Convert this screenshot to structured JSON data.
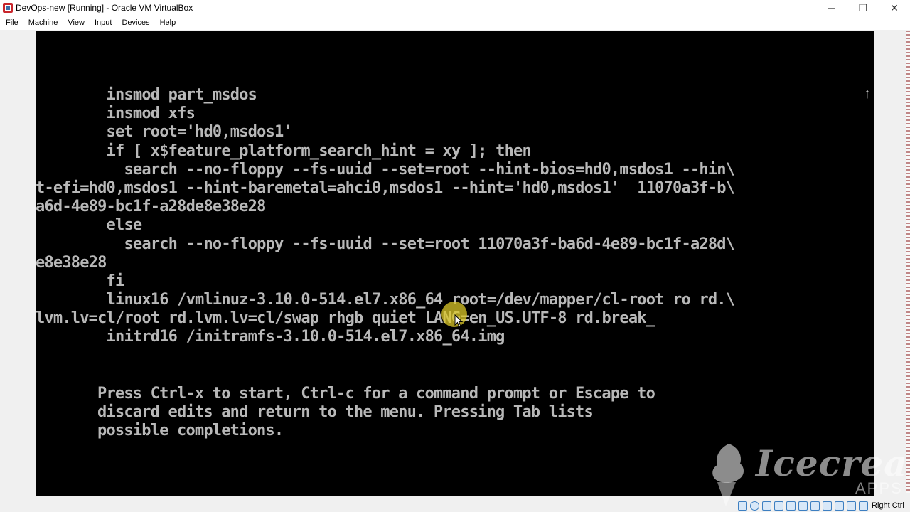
{
  "window": {
    "title": "DevOps-new [Running] - Oracle VM VirtualBox",
    "minimize_glyph": "─",
    "restore_glyph": "❐",
    "close_glyph": "✕"
  },
  "menu": {
    "items": [
      "File",
      "Machine",
      "View",
      "Input",
      "Devices",
      "Help"
    ]
  },
  "terminal": {
    "lines": [
      "        insmod part_msdos",
      "        insmod xfs",
      "        set root='hd0,msdos1'",
      "        if [ x$feature_platform_search_hint = xy ]; then",
      "          search --no-floppy --fs-uuid --set=root --hint-bios=hd0,msdos1 --hin\\",
      "t-efi=hd0,msdos1 --hint-baremetal=ahci0,msdos1 --hint='hd0,msdos1'  11070a3f-b\\",
      "a6d-4e89-bc1f-a28de8e38e28",
      "        else",
      "          search --no-floppy --fs-uuid --set=root 11070a3f-ba6d-4e89-bc1f-a28d\\",
      "e8e38e28",
      "        fi",
      "        linux16 /vmlinuz-3.10.0-514.el7.x86_64 root=/dev/mapper/cl-root ro rd.\\",
      "lvm.lv=cl/root rd.lvm.lv=cl/swap rhgb quiet LANG=en_US.UTF-8 rd.break_",
      "        initrd16 /initramfs-3.10.0-514.el7.x86_64.img"
    ],
    "help_lines": [
      "Press Ctrl-x to start, Ctrl-c for a command prompt or Escape to",
      "discard edits and return to the menu. Pressing Tab lists",
      "possible completions."
    ],
    "scroll_indicator": "↑"
  },
  "watermark": {
    "brand": "Icecream",
    "sub": "APPS"
  },
  "statusbar": {
    "host_key_label": "Right Ctrl"
  },
  "colors": {
    "terminal_bg": "#000000",
    "terminal_fg": "#b8b8b8",
    "cursor_highlight": "#dcc828"
  }
}
